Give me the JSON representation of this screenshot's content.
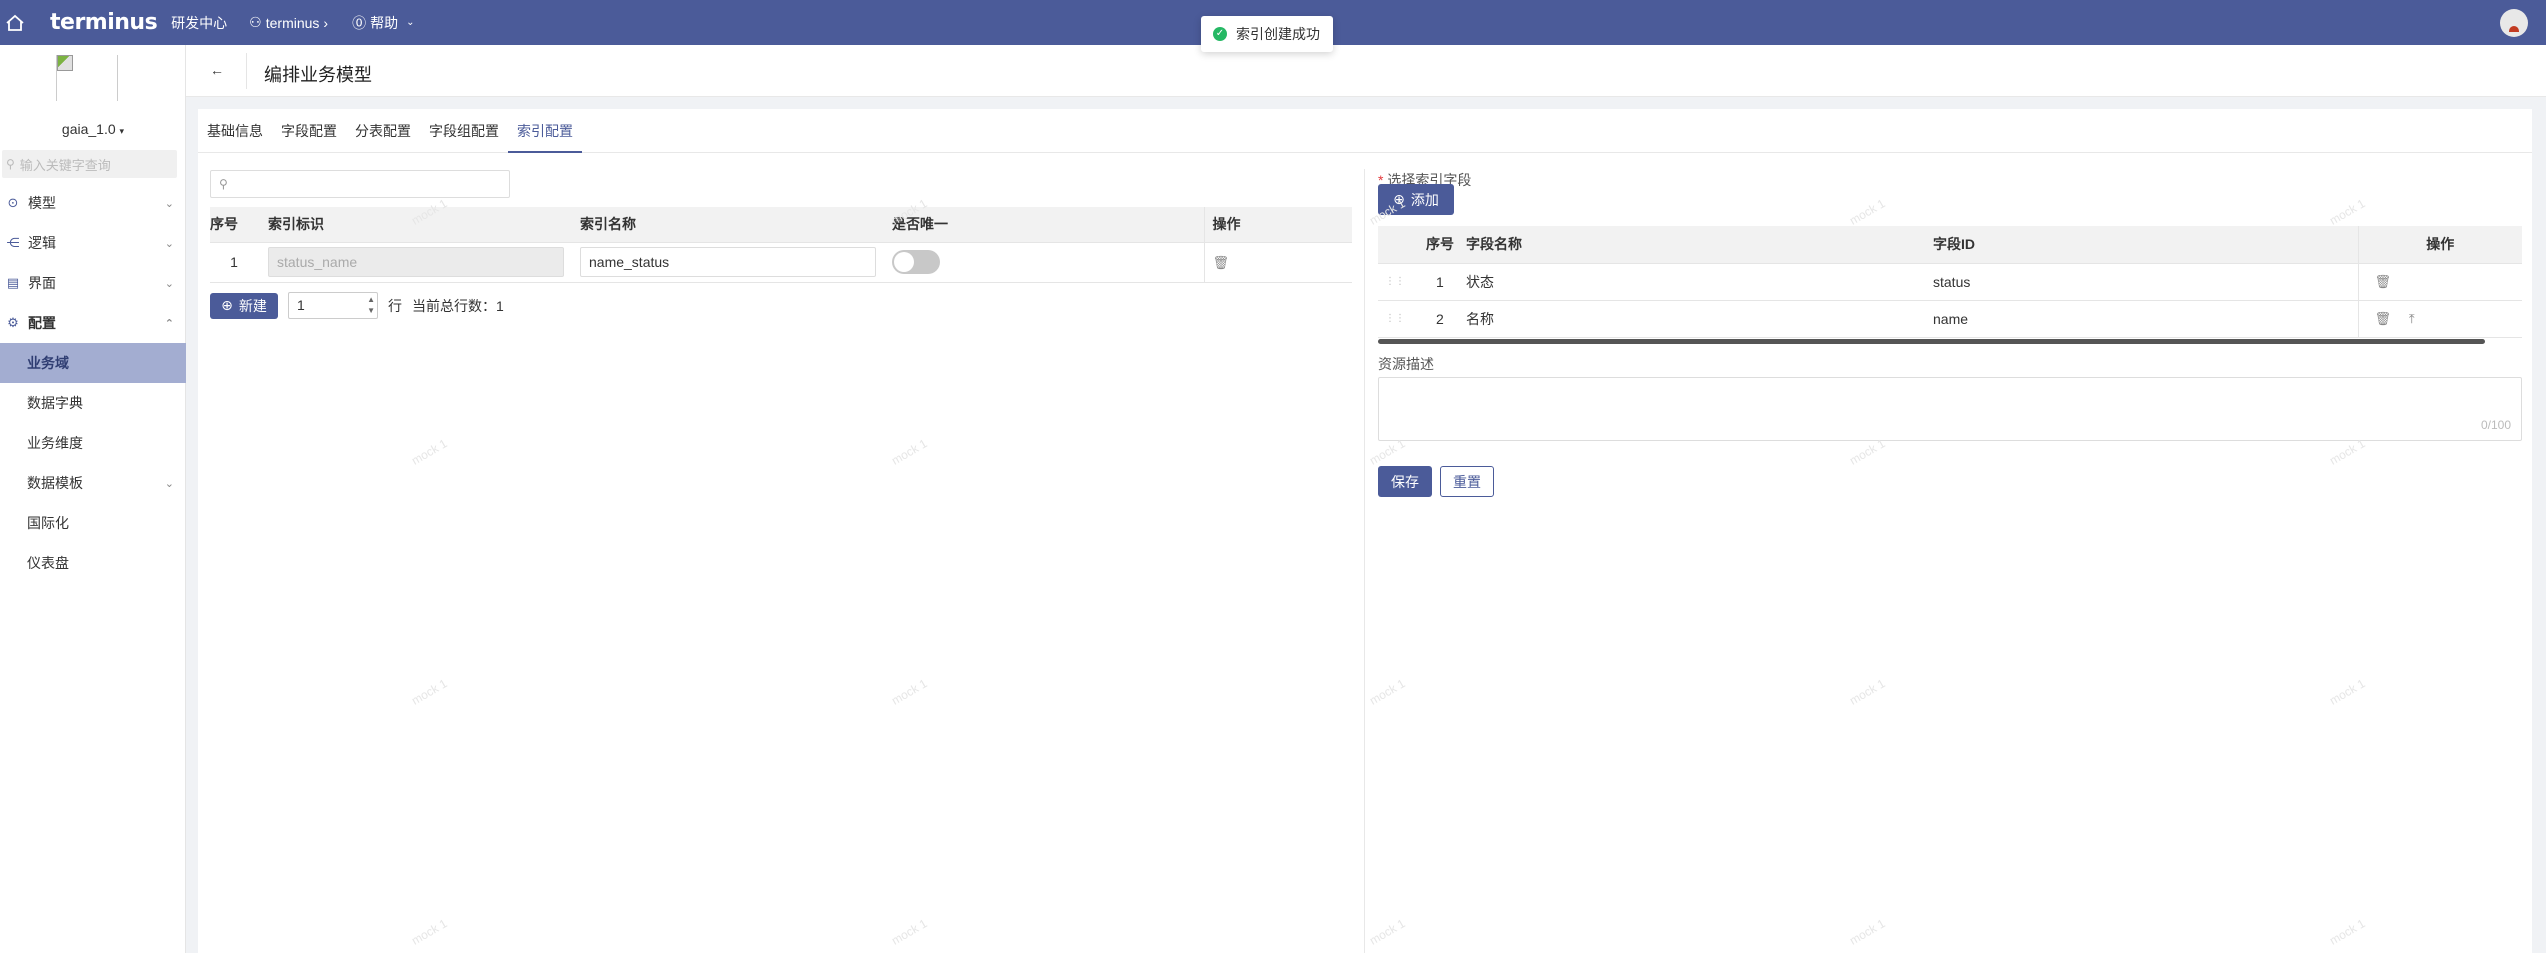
{
  "topbar": {
    "brand": "terminus",
    "nav_rd": "研发中心",
    "nav_user": "terminus",
    "nav_help": "帮助"
  },
  "toast": {
    "message": "索引创建成功"
  },
  "sidebar": {
    "version": "gaia_1.0",
    "search_placeholder": "输入关键字查询",
    "groups": [
      {
        "label": "模型"
      },
      {
        "label": "逻辑"
      },
      {
        "label": "界面"
      },
      {
        "label": "配置"
      }
    ],
    "sub_items": [
      {
        "label": "业务域"
      },
      {
        "label": "数据字典"
      },
      {
        "label": "业务维度"
      },
      {
        "label": "数据模板"
      },
      {
        "label": "国际化"
      },
      {
        "label": "仪表盘"
      }
    ]
  },
  "header": {
    "back": "←",
    "title": "编排业务模型"
  },
  "tabs": [
    "基础信息",
    "字段配置",
    "分表配置",
    "字段组配置",
    "索引配置"
  ],
  "left": {
    "columns": [
      "序号",
      "索引标识",
      "索引名称",
      "是否唯一",
      "操作"
    ],
    "rows": [
      {
        "no": "1",
        "key": "status_name",
        "name": "name_status"
      }
    ],
    "new_button": "新建",
    "page_value": "1",
    "row_label": "行",
    "total_label": "当前总行数：1"
  },
  "right": {
    "select_label": "选择索引字段",
    "add_button": "添加",
    "columns": [
      "序号",
      "字段名称",
      "字段ID",
      "操作"
    ],
    "rows": [
      {
        "no": "1",
        "name": "状态",
        "id": "status"
      },
      {
        "no": "2",
        "name": "名称",
        "id": "name"
      }
    ],
    "desc_label": "资源描述",
    "counter": "0/100",
    "save_button": "保存",
    "reset_button": "重置"
  },
  "watermark": "mock 1"
}
